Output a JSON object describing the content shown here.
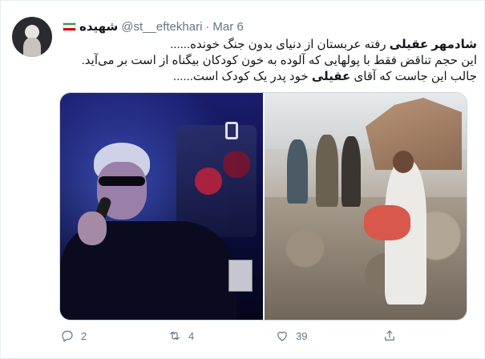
{
  "tweet": {
    "display_name": "شهیده",
    "handle": "@st__eftekhari",
    "separator": "·",
    "date": "Mar 6",
    "line1_bold": "شادمهر عقیلی",
    "line1_rest": " رفته عربستان از دنیای بدون جنگ خونده......",
    "line2": "این حجم تناقض فقط با پولهایی که آلوده به خون کودکان بیگناه از است بر می‌آید.",
    "line3_pre": "جالب این جاست که آقای ",
    "line3_bold": "عقیلی",
    "line3_post": " خود پدر یک کودک است......"
  },
  "actions": {
    "reply_count": "2",
    "retweet_count": "4",
    "like_count": "39"
  },
  "icons": {
    "avatar": "avatar",
    "flag": "iran-flag-icon",
    "reply": "reply-icon",
    "retweet": "retweet-icon",
    "like": "heart-icon",
    "share": "share-icon"
  },
  "colors": {
    "text": "#14171a",
    "secondary": "#657786",
    "border": "#e6ecf0"
  }
}
